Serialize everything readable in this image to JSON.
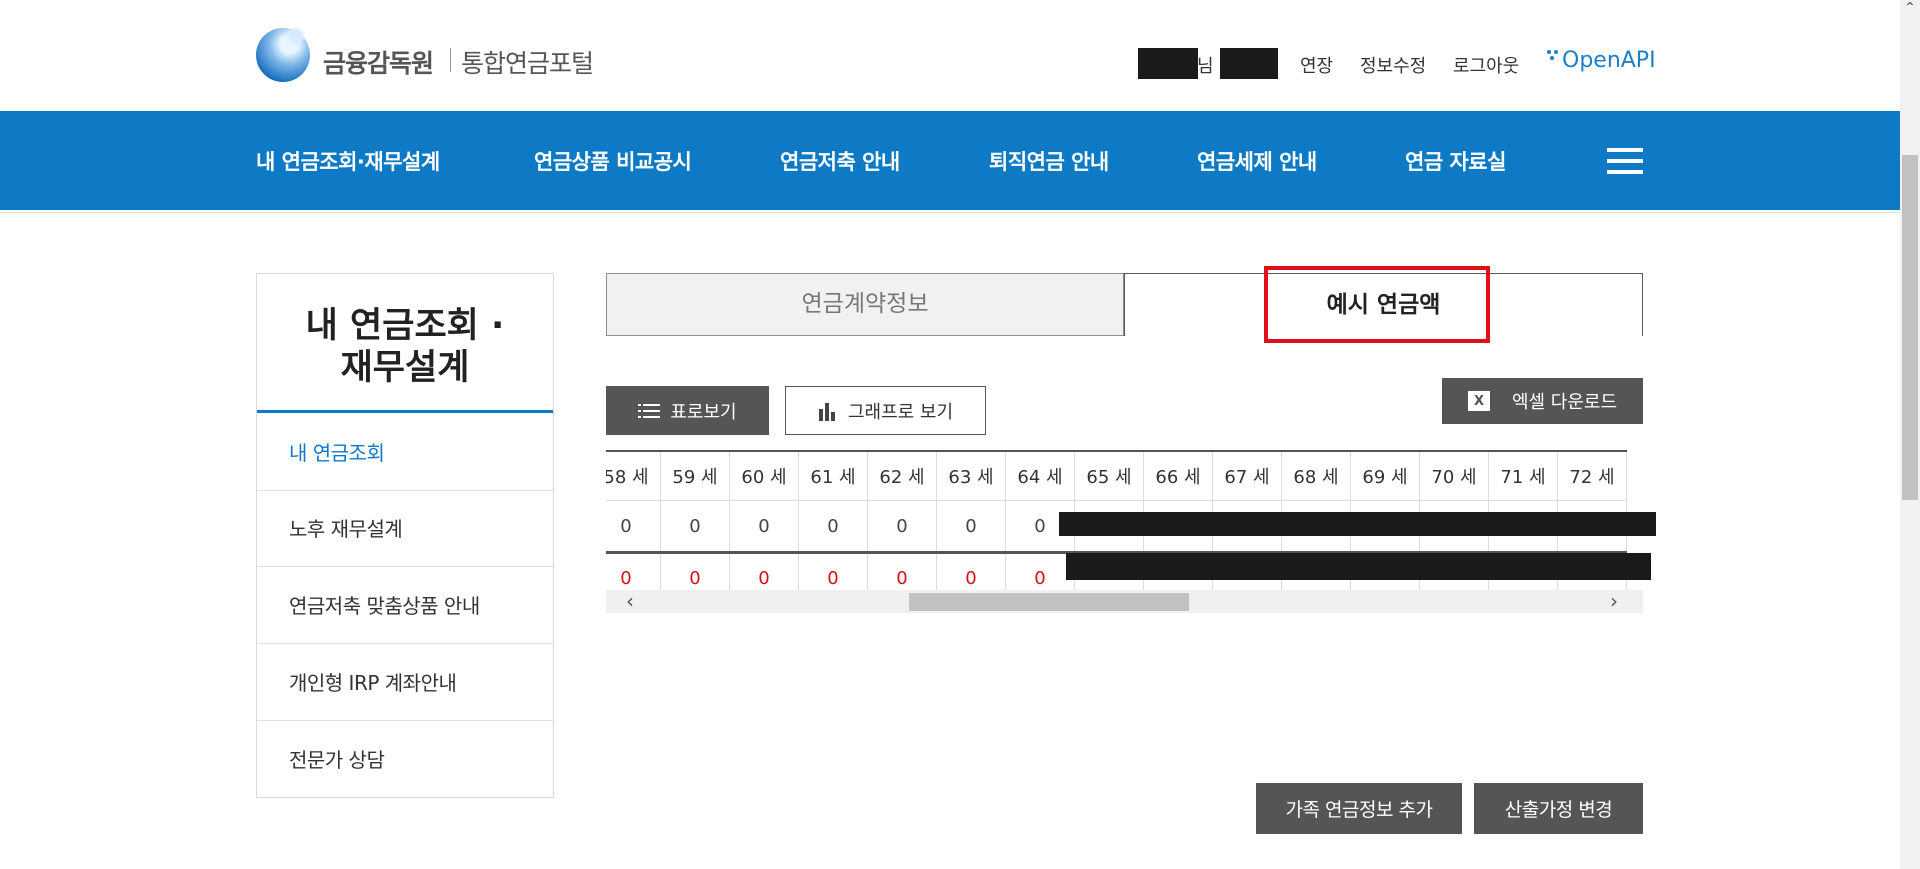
{
  "header": {
    "logo_main": "금융감독원",
    "logo_sub": "통합연금포털",
    "user_suffix": "님",
    "links": [
      "연장",
      "정보수정",
      "로그아웃"
    ],
    "openapi": "OpenAPI"
  },
  "nav": {
    "items": [
      "내 연금조회·재무설계",
      "연금상품 비교공시",
      "연금저축 안내",
      "퇴직연금 안내",
      "연금세제 안내",
      "연금 자료실"
    ]
  },
  "sidebar": {
    "title_line1": "내 연금조회 ·",
    "title_line2": "재무설계",
    "items": [
      "내 연금조회",
      "노후 재무설계",
      "연금저축 맞춤상품 안내",
      "개인형 IRP 계좌안내",
      "전문가 상담"
    ]
  },
  "tabs": {
    "contract": "연금계약정보",
    "example": "예시 연금액"
  },
  "buttons": {
    "table_view": "표로보기",
    "graph_view": "그래프로 보기",
    "excel": "엑셀 다운로드",
    "family": "가족 연금정보 추가",
    "assumption": "산출가정 변경"
  },
  "table": {
    "headers": [
      "58 세",
      "59 세",
      "60 세",
      "61 세",
      "62 세",
      "63 세",
      "64 세",
      "65 세",
      "66 세",
      "67 세",
      "68 세",
      "69 세",
      "70 세",
      "71 세",
      "72 세"
    ],
    "row1": [
      "0",
      "0",
      "0",
      "0",
      "0",
      "0",
      "0",
      "",
      "",
      "",
      "",
      "",
      "",
      "",
      ""
    ],
    "row2": [
      "0",
      "0",
      "0",
      "0",
      "0",
      "0",
      "0",
      "",
      "",
      "",
      "",
      "",
      "",
      "",
      ""
    ]
  },
  "colors": {
    "primary": "#0e7ac5",
    "highlight": "#e0101b",
    "dark_button": "#555555",
    "negative_text": "#d4101b"
  }
}
